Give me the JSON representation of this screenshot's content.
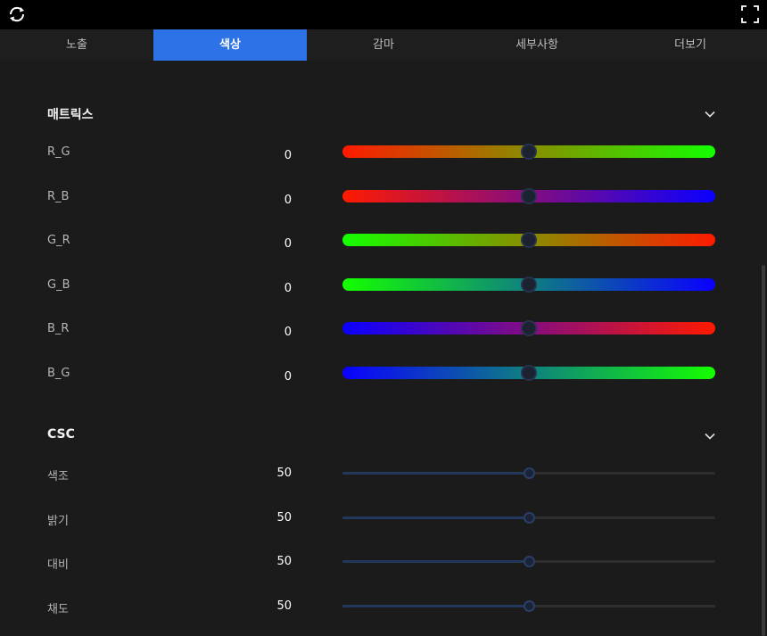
{
  "toolbar": {
    "refresh_icon": "refresh-icon",
    "fullscreen_icon": "fullscreen-icon"
  },
  "tabs": [
    {
      "label": "노출",
      "active": false
    },
    {
      "label": "색상",
      "active": true
    },
    {
      "label": "감마",
      "active": false
    },
    {
      "label": "세부사항",
      "active": false
    },
    {
      "label": "더보기",
      "active": false
    }
  ],
  "matrix": {
    "title": "매트릭스",
    "rows": [
      {
        "label": "R_G",
        "value": "0",
        "level": 0.5,
        "from": "#ff1a00",
        "to": "#14ff00"
      },
      {
        "label": "R_B",
        "value": "0",
        "level": 0.5,
        "from": "#ff1a00",
        "to": "#0a00ff"
      },
      {
        "label": "G_R",
        "value": "0",
        "level": 0.5,
        "from": "#14ff00",
        "to": "#ff1a00"
      },
      {
        "label": "G_B",
        "value": "0",
        "level": 0.5,
        "from": "#14ff00",
        "to": "#0a00ff"
      },
      {
        "label": "B_R",
        "value": "0",
        "level": 0.5,
        "from": "#0a00ff",
        "to": "#ff1a00"
      },
      {
        "label": "B_G",
        "value": "0",
        "level": 0.5,
        "from": "#0a00ff",
        "to": "#14ff00"
      }
    ]
  },
  "csc": {
    "title": "CSC",
    "rows": [
      {
        "label": "색조",
        "value": "50",
        "level": 0.5
      },
      {
        "label": "밝기",
        "value": "50",
        "level": 0.5
      },
      {
        "label": "대비",
        "value": "50",
        "level": 0.5
      },
      {
        "label": "채도",
        "value": "50",
        "level": 0.5
      }
    ]
  },
  "colors": {
    "accent": "#2e72e8",
    "background": "#1b1b1b"
  }
}
